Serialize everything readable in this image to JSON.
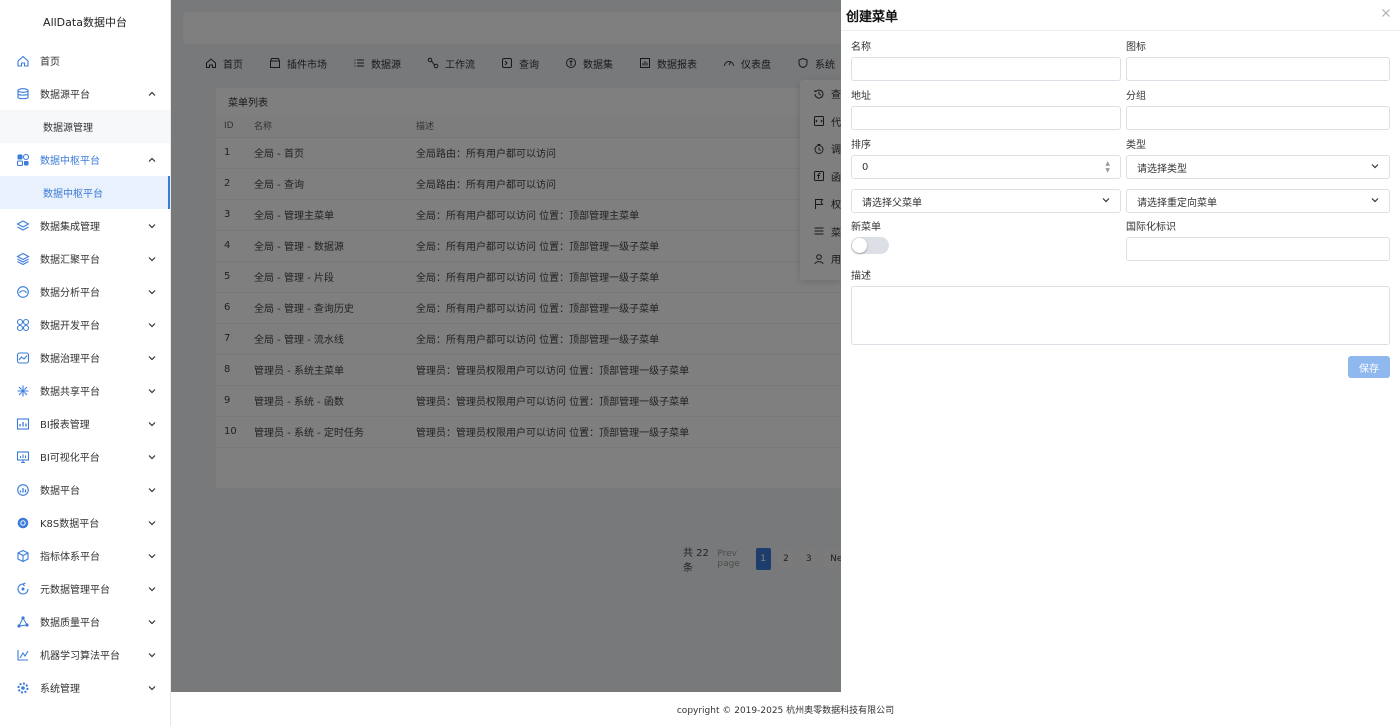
{
  "sidebar": {
    "brand": "AllData数据中台",
    "items": [
      {
        "label": "首页",
        "icon": "home-icon"
      },
      {
        "label": "数据源平台",
        "icon": "database-icon",
        "expanded": true,
        "children": [
          "数据源管理"
        ]
      },
      {
        "label": "数据中枢平台",
        "icon": "hub-icon",
        "expanded": true,
        "active": true,
        "children": [
          "数据中枢平台"
        ]
      },
      {
        "label": "数据集成管理",
        "icon": "layers-icon"
      },
      {
        "label": "数据汇聚平台",
        "icon": "stack-icon"
      },
      {
        "label": "数据分析平台",
        "icon": "analytics-icon"
      },
      {
        "label": "数据开发平台",
        "icon": "dev-icon"
      },
      {
        "label": "数据治理平台",
        "icon": "governance-icon"
      },
      {
        "label": "数据共享平台",
        "icon": "share-icon"
      },
      {
        "label": "BI报表管理",
        "icon": "report-icon"
      },
      {
        "label": "BI可视化平台",
        "icon": "visual-icon"
      },
      {
        "label": "数据平台",
        "icon": "chart-icon"
      },
      {
        "label": "K8S数据平台",
        "icon": "k8s-icon"
      },
      {
        "label": "指标体系平台",
        "icon": "cube-icon"
      },
      {
        "label": "元数据管理平台",
        "icon": "meta-icon"
      },
      {
        "label": "数据质量平台",
        "icon": "quality-icon"
      },
      {
        "label": "机器学习算法平台",
        "icon": "ml-icon"
      },
      {
        "label": "系统管理",
        "icon": "settings-icon"
      }
    ]
  },
  "tabs": [
    {
      "label": "首页",
      "icon": "home-icon"
    },
    {
      "label": "插件市场",
      "icon": "store-icon"
    },
    {
      "label": "数据源",
      "icon": "list-icon"
    },
    {
      "label": "工作流",
      "icon": "flow-icon"
    },
    {
      "label": "查询",
      "icon": "terminal-icon"
    },
    {
      "label": "数据集",
      "icon": "dataset-icon"
    },
    {
      "label": "数据报表",
      "icon": "report-icon"
    },
    {
      "label": "仪表盘",
      "icon": "gauge-icon"
    },
    {
      "label": "系统",
      "icon": "shield-icon"
    }
  ],
  "dropdown": [
    {
      "label": "查",
      "icon": "history-icon"
    },
    {
      "label": "代",
      "icon": "code-icon"
    },
    {
      "label": "调",
      "icon": "timer-icon"
    },
    {
      "label": "函",
      "icon": "function-icon"
    },
    {
      "label": "权",
      "icon": "flag-icon"
    },
    {
      "label": "菜",
      "icon": "menu-icon"
    },
    {
      "label": "用",
      "icon": "user-icon"
    }
  ],
  "table": {
    "title": "菜单列表",
    "columns": [
      "ID",
      "名称",
      "描述"
    ],
    "rows": [
      [
        "1",
        "全局 - 首页",
        "全局路由：所有用户都可以访问"
      ],
      [
        "2",
        "全局 - 查询",
        "全局路由：所有用户都可以访问"
      ],
      [
        "3",
        "全局 - 管理主菜单",
        "全局：所有用户都可以访问 位置：顶部管理主菜单"
      ],
      [
        "4",
        "全局 - 管理 - 数据源",
        "全局：所有用户都可以访问 位置：顶部管理一级子菜单"
      ],
      [
        "5",
        "全局 - 管理 - 片段",
        "全局：所有用户都可以访问 位置：顶部管理一级子菜单"
      ],
      [
        "6",
        "全局 - 管理 - 查询历史",
        "全局：所有用户都可以访问 位置：顶部管理一级子菜单"
      ],
      [
        "7",
        "全局 - 管理 - 流水线",
        "全局：所有用户都可以访问 位置：顶部管理一级子菜单"
      ],
      [
        "8",
        "管理员 - 系统主菜单",
        "管理员：管理员权限用户可以访问 位置：顶部管理一级子菜单"
      ],
      [
        "9",
        "管理员 - 系统 - 函数",
        "管理员：管理员权限用户可以访问 位置：顶部管理一级子菜单"
      ],
      [
        "10",
        "管理员 - 系统 - 定时任务",
        "管理员：管理员权限用户可以访问 位置：顶部管理一级子菜单"
      ]
    ]
  },
  "pager": {
    "total": "共 22 条",
    "prev": "Prev page",
    "pages": [
      "1",
      "2",
      "3"
    ],
    "current": "1",
    "next": "Next"
  },
  "footer": "copyright © 2019-2025 杭州奥零数据科技有限公司",
  "drawer": {
    "title": "创建菜单",
    "fields": {
      "name_label": "名称",
      "icon_label": "图标",
      "path_label": "地址",
      "group_label": "分组",
      "order_label": "排序",
      "order_value": "0",
      "type_label": "类型",
      "type_placeholder": "请选择类型",
      "parent_placeholder": "请选择父菜单",
      "redirect_placeholder": "请选择重定向菜单",
      "new_label": "新菜单",
      "new_enabled": false,
      "i18n_label": "国际化标识",
      "desc_label": "描述"
    },
    "save_label": "保存"
  },
  "colors": {
    "accent": "#3b7bd9",
    "save_button": "#8fb8ef"
  }
}
